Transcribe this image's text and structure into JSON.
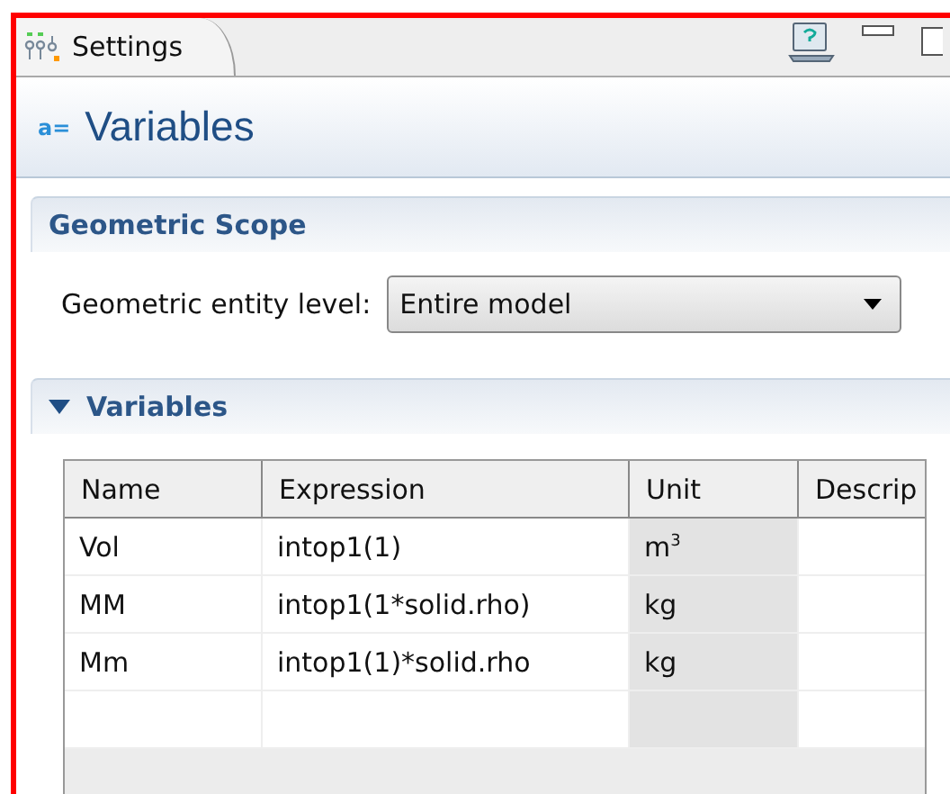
{
  "tab": {
    "title": "Settings"
  },
  "header": {
    "icon": "a=",
    "title": "Variables"
  },
  "geometric_scope": {
    "title": "Geometric Scope",
    "field_label": "Geometric entity level:",
    "value": "Entire model"
  },
  "variables": {
    "title": "Variables",
    "expanded": true,
    "table": {
      "columns": [
        "Name",
        "Expression",
        "Unit",
        "Descrip"
      ],
      "rows": [
        {
          "name": "Vol",
          "expression": "intop1(1)",
          "unit": "m$^{3}$"
        },
        {
          "name": "MM",
          "expression": "intop1(1*solid.rho)",
          "unit": "kg"
        },
        {
          "name": "Mm",
          "expression": "intop1(1)*solid.rho",
          "unit": "kg"
        }
      ]
    }
  }
}
